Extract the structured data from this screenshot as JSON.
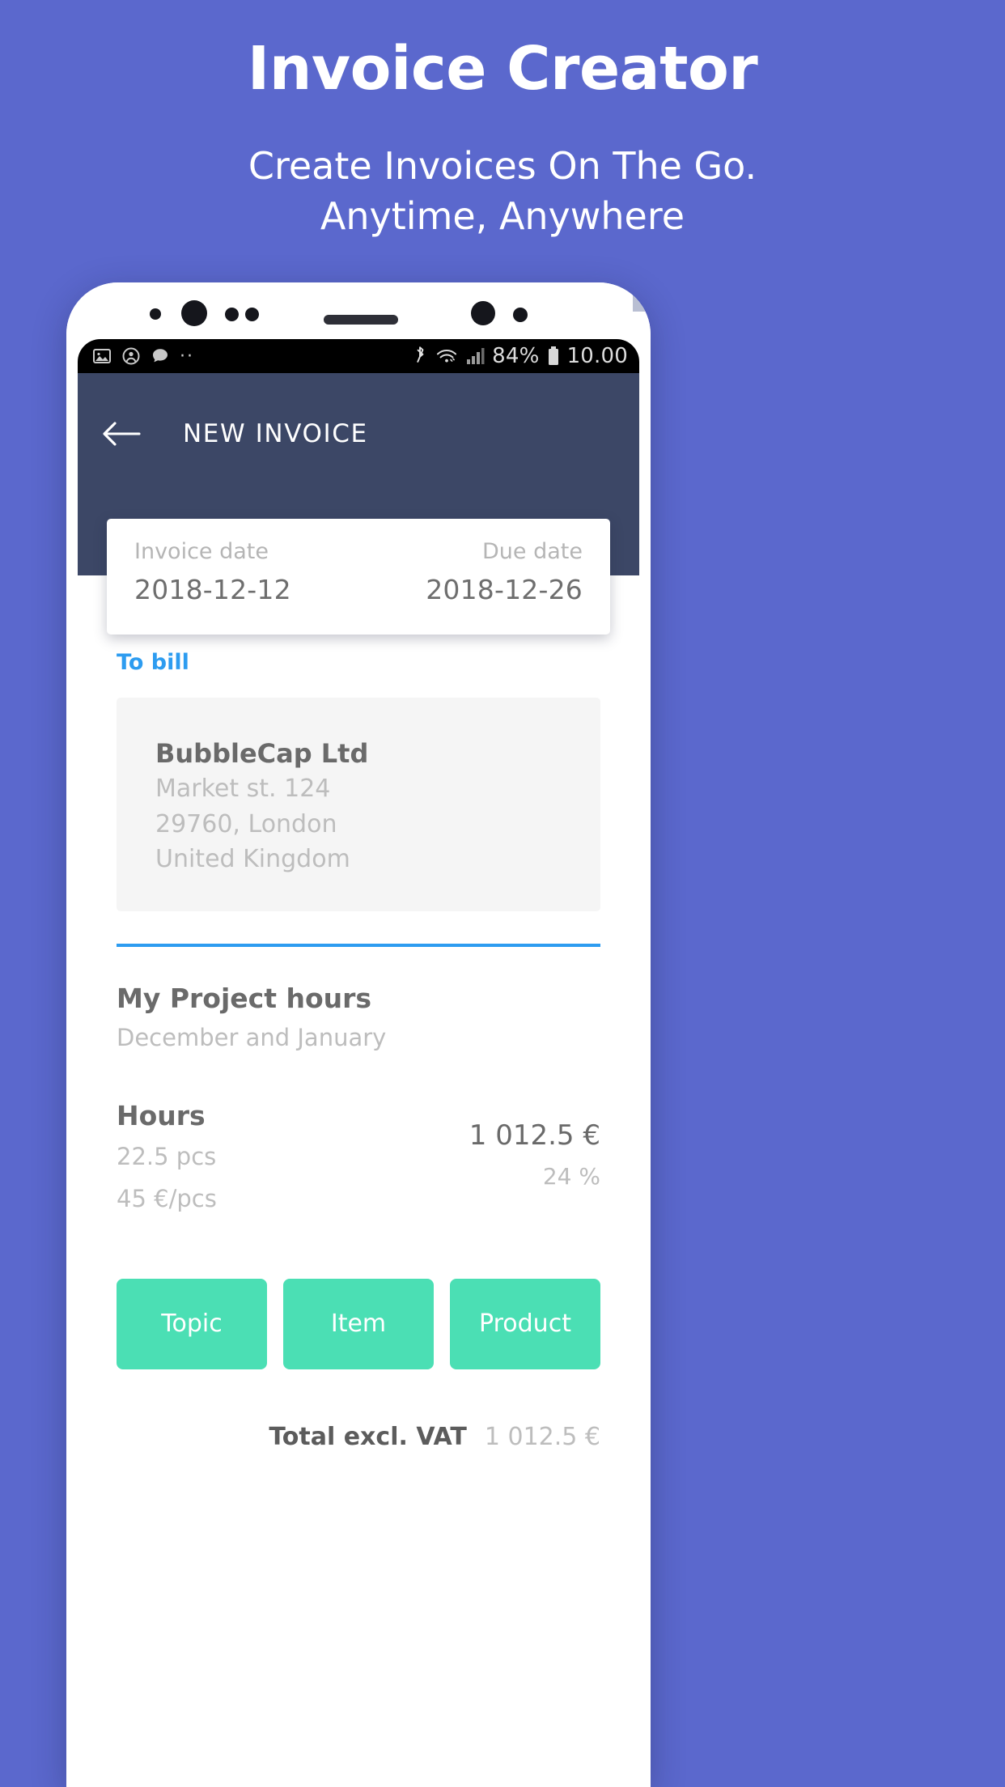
{
  "promo": {
    "title": "Invoice Creator",
    "subtitle_line1": "Create Invoices On The Go.",
    "subtitle_line2": "Anytime, Anywhere",
    "background_color": "#5b68cd"
  },
  "phone": {
    "statusbar": {
      "left_icons": [
        "image-icon",
        "account-icon",
        "chat-bubble-icon",
        "more-dots-icon"
      ],
      "bluetooth_icon": "bluetooth-icon",
      "wifi_icon": "wifi-icon",
      "signal_icon": "signal-icon",
      "battery_percent": "84%",
      "battery_icon": "battery-icon",
      "clock": "10.00"
    },
    "appbar": {
      "back_icon": "back-arrow-icon",
      "title": "NEW INVOICE",
      "background_color": "#3c4766"
    },
    "date_card": {
      "invoice_date_label": "Invoice date",
      "invoice_date_value": "2018-12-12",
      "due_date_label": "Due date",
      "due_date_value": "2018-12-26"
    },
    "to_bill": {
      "section_label": "To bill",
      "accent_color": "#2d9cf0",
      "company_name": "BubbleCap Ltd",
      "address_line1": "Market st. 124",
      "address_line2": "29760, London",
      "address_line3": "United Kingdom"
    },
    "project": {
      "title": "My Project hours",
      "subtitle": "December and January"
    },
    "line_item": {
      "name": "Hours",
      "quantity": "22.5 pcs",
      "unit_price": "45 €/pcs",
      "amount": "1 012.5 €",
      "vat": "24 %"
    },
    "buttons": [
      {
        "label": "Topic",
        "name": "topic-button"
      },
      {
        "label": "Item",
        "name": "item-button"
      },
      {
        "label": "Product",
        "name": "product-button"
      }
    ],
    "button_color": "#4bdfb4",
    "total": {
      "label": "Total excl. VAT",
      "value": "1 012.5 €"
    }
  }
}
